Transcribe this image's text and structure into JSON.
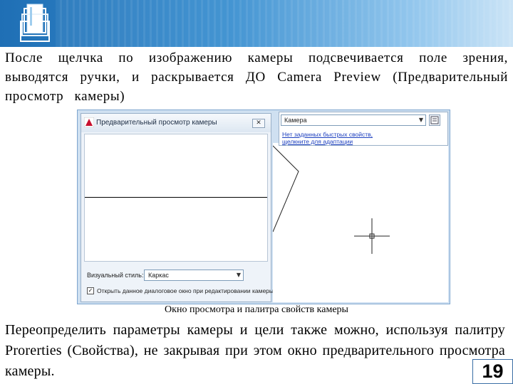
{
  "header": {
    "logo_icon": "stacked-pages-logo-icon"
  },
  "paragraph1": "После щелчка по изображению камеры подсвечивается поле зрения, выводятся ручки, и раскрывается ДО Camera Preview (Предварительный просмотр камеры)",
  "screenshot": {
    "dialog": {
      "title": "Предварительный просмотр камеры",
      "close_label": "✕",
      "visual_style_label": "Визуальный стиль:",
      "visual_style_value": "Каркас",
      "checkbox_label": "Открыть данное диалоговое окно при редактировании камеры",
      "checkbox_checked": true
    },
    "properties": {
      "selected_object": "Камера",
      "link_line1": "Нет заданных быстрых свойств,",
      "link_line2": "щелкните для адаптации"
    }
  },
  "caption": "Окно просмотра и палитра свойств камеры",
  "paragraph2": "Переопределить параметры камеры и цели также можно, используя палитру Prorerties (Свойства), не закрывая при этом окно предварительного просмотра камеры.",
  "page_number": "19"
}
